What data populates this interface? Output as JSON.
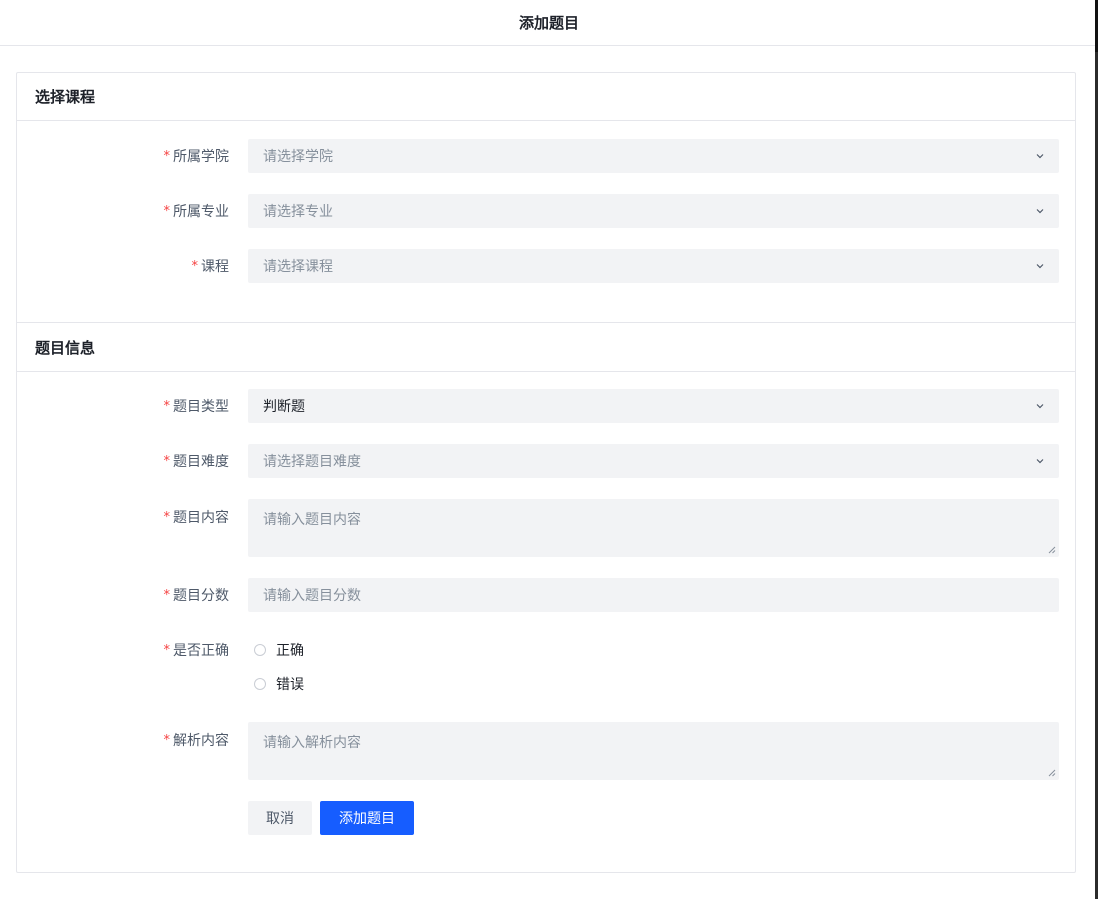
{
  "dialog": {
    "title": "添加题目"
  },
  "sections": {
    "course": {
      "title": "选择课程"
    },
    "question": {
      "title": "题目信息"
    }
  },
  "form": {
    "college": {
      "label": "所属学院",
      "placeholder": "请选择学院"
    },
    "major": {
      "label": "所属专业",
      "placeholder": "请选择专业"
    },
    "course": {
      "label": "课程",
      "placeholder": "请选择课程"
    },
    "question_type": {
      "label": "题目类型",
      "value": "判断题"
    },
    "difficulty": {
      "label": "题目难度",
      "placeholder": "请选择题目难度"
    },
    "content": {
      "label": "题目内容",
      "placeholder": "请输入题目内容"
    },
    "score": {
      "label": "题目分数",
      "placeholder": "请输入题目分数"
    },
    "correct": {
      "label": "是否正确",
      "options": [
        "正确",
        "错误"
      ]
    },
    "analysis": {
      "label": "解析内容",
      "placeholder": "请输入解析内容"
    }
  },
  "buttons": {
    "cancel": "取消",
    "submit": "添加题目"
  },
  "required_mark": "*",
  "colors": {
    "primary": "#165dff",
    "required": "#f53f3f",
    "field_bg": "#f2f3f5"
  }
}
